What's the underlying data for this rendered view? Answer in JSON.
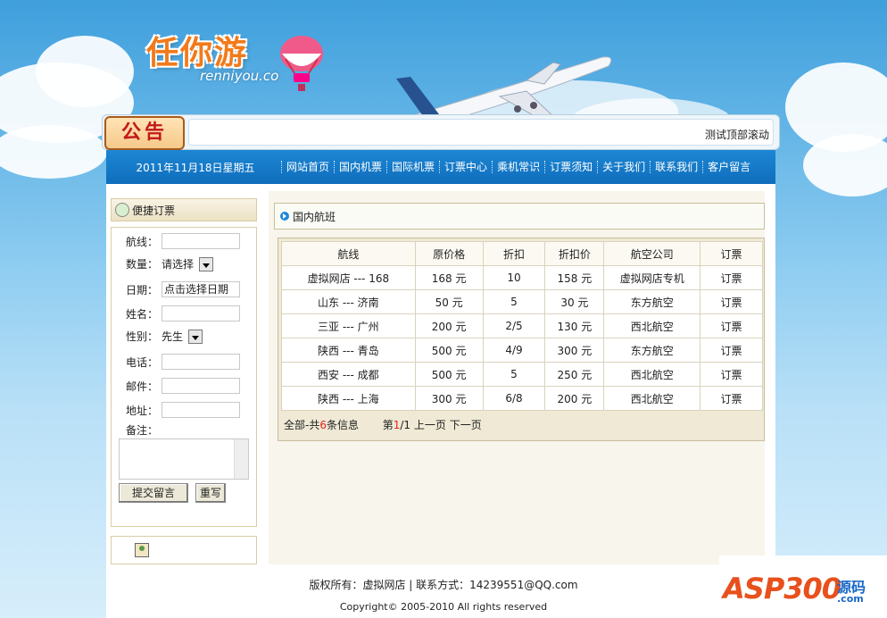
{
  "logo": {
    "title": "任你游",
    "subtitle": "renniyou.co"
  },
  "notice": {
    "badge": "公告",
    "scroll_text": "测试顶部滚动"
  },
  "nav": {
    "date": "2011年11月18日星期五",
    "items": [
      "网站首页",
      "国内机票",
      "国际机票",
      "订票中心",
      "乘机常识",
      "订票须知",
      "关于我们",
      "联系我们",
      "客户留言"
    ]
  },
  "sidebar": {
    "title": "便捷订票",
    "fields": {
      "route": "航线：",
      "quantity": "数量：",
      "quantity_value": "请选择",
      "date": "日期：",
      "date_value": "点击选择日期",
      "name": "姓名：",
      "gender": "性别：",
      "gender_value": "先生",
      "phone": "电话：",
      "email": "邮件：",
      "address": "地址：",
      "remark": "备注："
    },
    "submit_label": "提交留言",
    "reset_label": "重写"
  },
  "content": {
    "title": "国内航班",
    "headers": [
      "航线",
      "原价格",
      "折扣",
      "折扣价",
      "航空公司",
      "订票"
    ],
    "rows": [
      [
        "虚拟网店 --- 168",
        "168 元",
        "10",
        "158 元",
        "虚拟网店专机",
        "订票"
      ],
      [
        "山东 --- 济南",
        "50 元",
        "5",
        "30 元",
        "东方航空",
        "订票"
      ],
      [
        "三亚 --- 广州",
        "200 元",
        "2/5",
        "130 元",
        "西北航空",
        "订票"
      ],
      [
        "陕西 --- 青岛",
        "500 元",
        "4/9",
        "300 元",
        "东方航空",
        "订票"
      ],
      [
        "西安 --- 成都",
        "500 元",
        "5",
        "250 元",
        "西北航空",
        "订票"
      ],
      [
        "陕西 --- 上海",
        "300 元",
        "6/8",
        "200 元",
        "西北航空",
        "订票"
      ]
    ],
    "summary_prefix": "全部-共",
    "summary_count": "6",
    "summary_suffix": "条信息",
    "page_prefix": "第",
    "page_current": "1",
    "page_suffix": "/1",
    "prev": "上一页",
    "next": "下一页"
  },
  "footer": {
    "line1": "版权所有：虚拟网店 | 联系方式：14239551@QQ.com",
    "line2": "Copyright© 2005-2010 All rights reserved"
  },
  "watermark": {
    "brand": "ASP300",
    "cn": "源码",
    "com": ".com"
  }
}
